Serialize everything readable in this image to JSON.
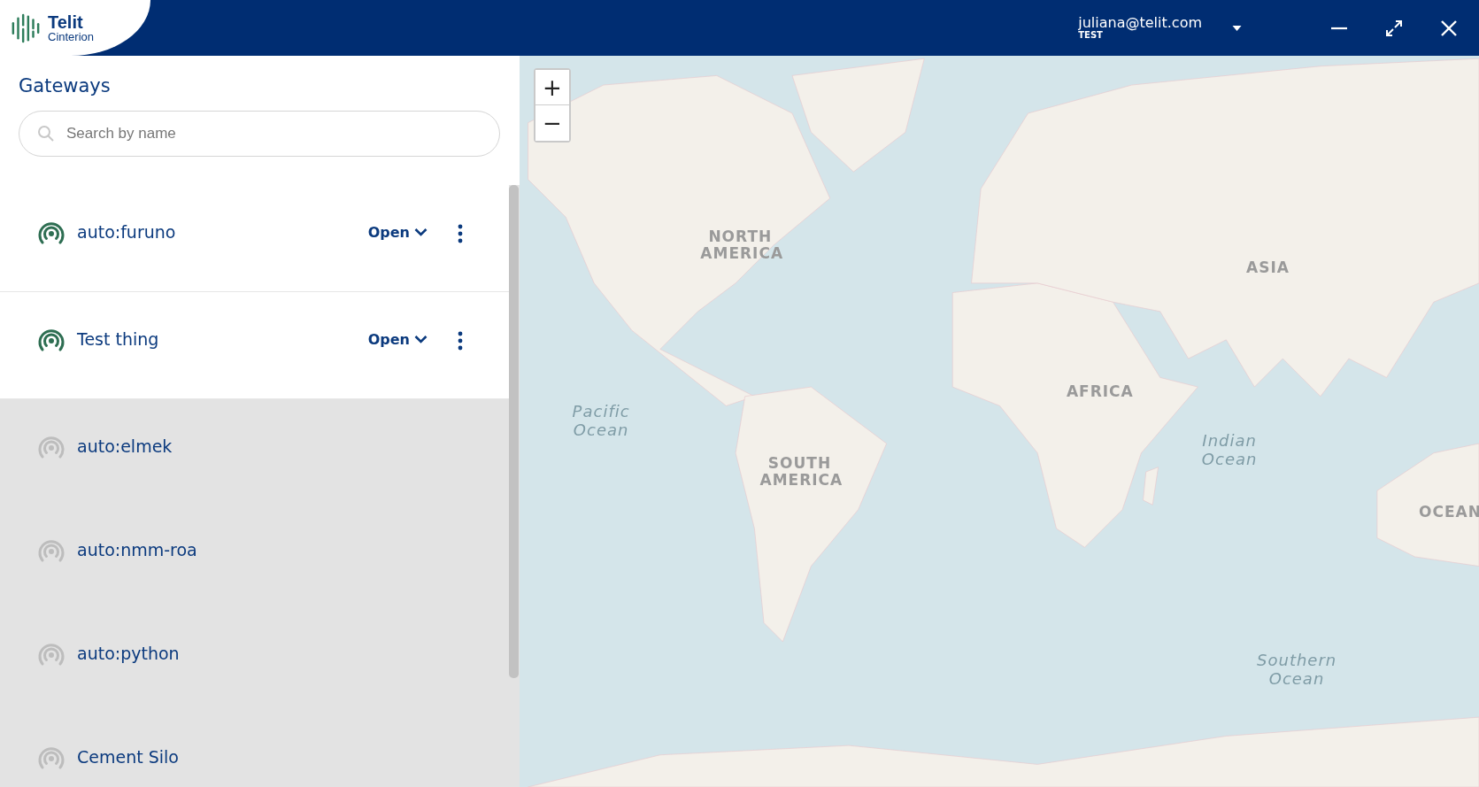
{
  "header": {
    "logo": {
      "name": "Telit",
      "subname": "Cinterion"
    },
    "user": {
      "email": "juliana@telit.com",
      "account": "TEST"
    }
  },
  "sidebar": {
    "title": "Gateways",
    "search": {
      "placeholder": "Search by name"
    },
    "gateways": [
      {
        "name": "auto:furuno",
        "online": true,
        "action": "Open"
      },
      {
        "name": "Test thing",
        "online": true,
        "action": "Open"
      },
      {
        "name": "auto:elmek",
        "online": false
      },
      {
        "name": "auto:nmm-roa",
        "online": false
      },
      {
        "name": "auto:python",
        "online": false
      },
      {
        "name": "Cement Silo",
        "online": false
      }
    ]
  },
  "map": {
    "zoom_in": "+",
    "zoom_out": "−",
    "labels": [
      {
        "text": "NORTH AMERICA",
        "kind": "region"
      },
      {
        "text": "ASIA",
        "kind": "region"
      },
      {
        "text": "AFRICA",
        "kind": "region"
      },
      {
        "text": "SOUTH AMERICA",
        "kind": "region"
      },
      {
        "text": "Pacific Ocean",
        "kind": "ocean"
      },
      {
        "text": "Indian Ocean",
        "kind": "ocean"
      },
      {
        "text": "Southern Ocean",
        "kind": "ocean"
      },
      {
        "text": "OCEAN",
        "kind": "region"
      }
    ]
  }
}
